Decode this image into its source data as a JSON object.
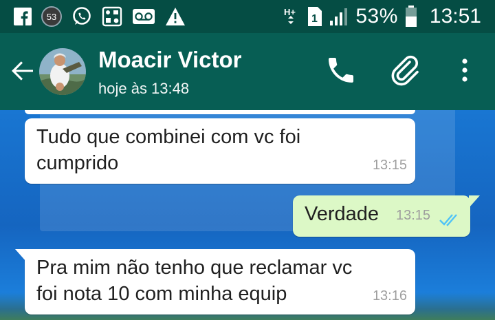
{
  "status_bar": {
    "notification_count": "53",
    "network_type": "H+",
    "sim_slot": "1",
    "battery": "53%",
    "time": "13:51",
    "icons": [
      "facebook-icon",
      "whatsapp-icon",
      "gallery-icon",
      "voicemail-icon",
      "warning-icon"
    ]
  },
  "header": {
    "contact_name": "Moacir Victor",
    "last_seen": "hoje às 13:48",
    "icons": [
      "back-arrow-icon",
      "phone-icon",
      "attach-icon",
      "more-vert-icon"
    ]
  },
  "messages": [
    {
      "direction": "in",
      "text_lines": [
        "Tudo que combinei com vc foi",
        "cumprido"
      ],
      "time": "13:15"
    },
    {
      "direction": "out",
      "text_lines": [
        "Verdade"
      ],
      "time": "13:15",
      "read": true
    },
    {
      "direction": "in",
      "text_lines": [
        "Pra mim não tenho que reclamar vc",
        "foi nota 10 com minha equip"
      ],
      "time": "13:16"
    }
  ],
  "colors": {
    "status_bar": "#054d44",
    "toolbar": "#075e54",
    "incoming_bubble": "#ffffff",
    "outgoing_bubble": "#dcf8c6",
    "read_ticks": "#4fc3f7",
    "wallpaper": "#1565c0"
  }
}
